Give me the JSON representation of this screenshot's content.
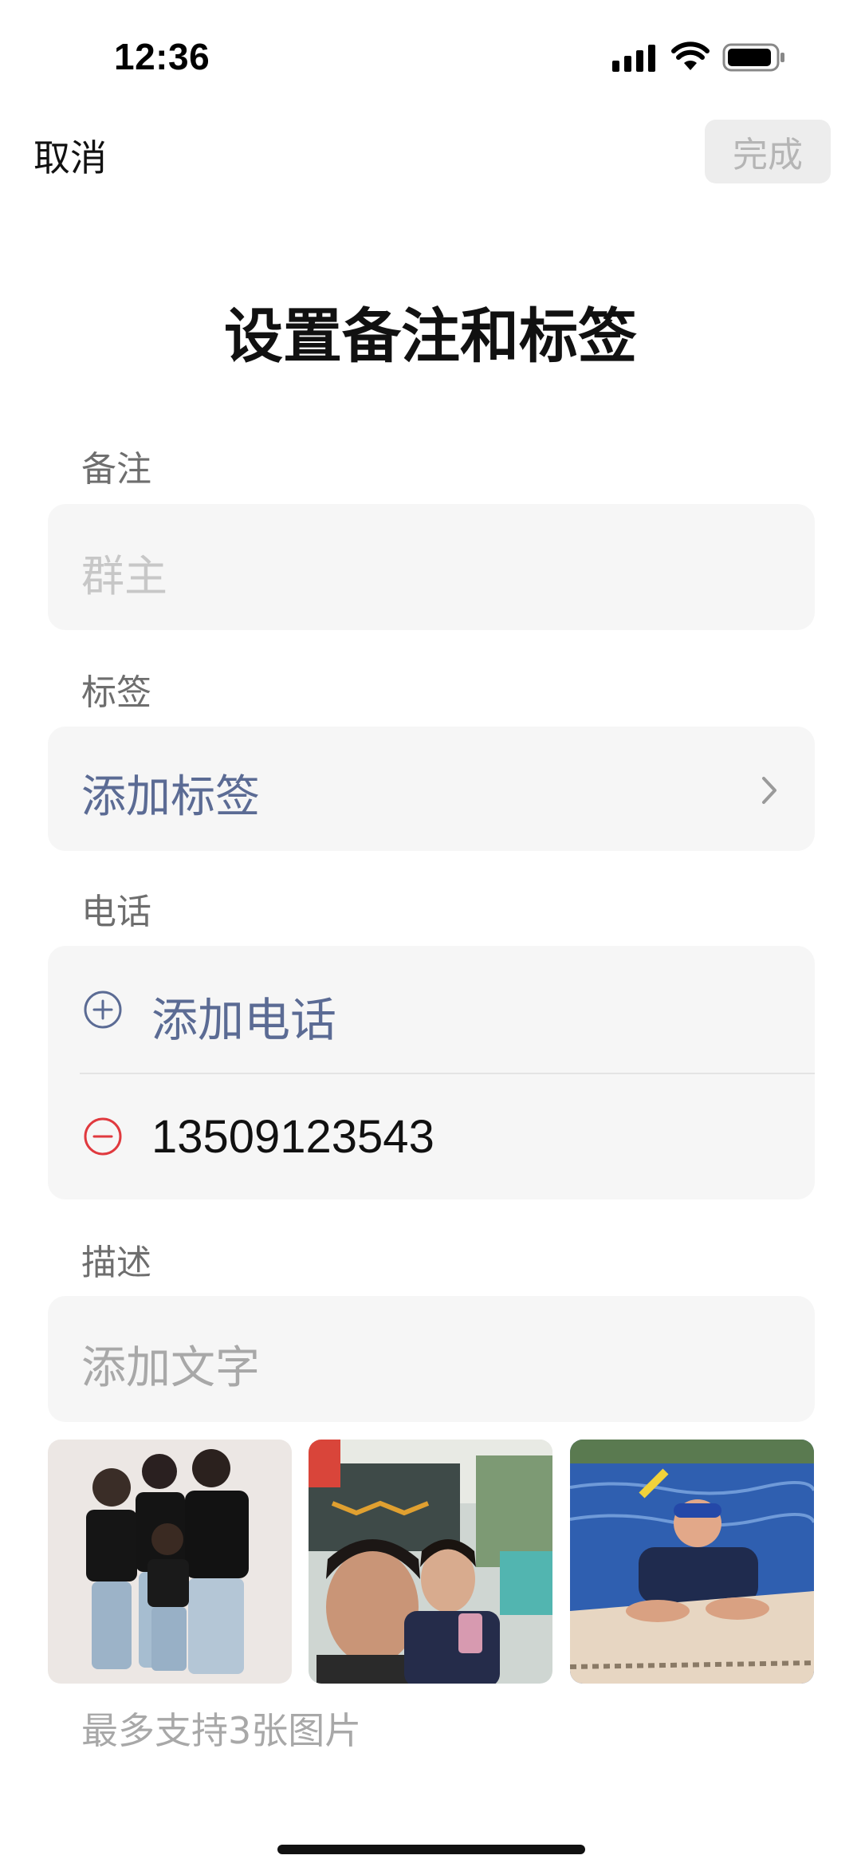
{
  "status_bar": {
    "time": "12:36"
  },
  "nav": {
    "cancel_label": "取消",
    "done_label": "完成"
  },
  "title": "设置备注和标签",
  "remark": {
    "label": "备注",
    "placeholder": "群主"
  },
  "tags": {
    "label": "标签",
    "add_label": "添加标签"
  },
  "phone": {
    "label": "电话",
    "add_label": "添加电话",
    "number": "13509123543"
  },
  "description": {
    "label": "描述",
    "placeholder": "添加文字",
    "photo_note": "最多支持3张图片"
  },
  "colors": {
    "link": "#5b6b94",
    "remove": "#e0393e",
    "card_bg": "#f6f6f6"
  }
}
